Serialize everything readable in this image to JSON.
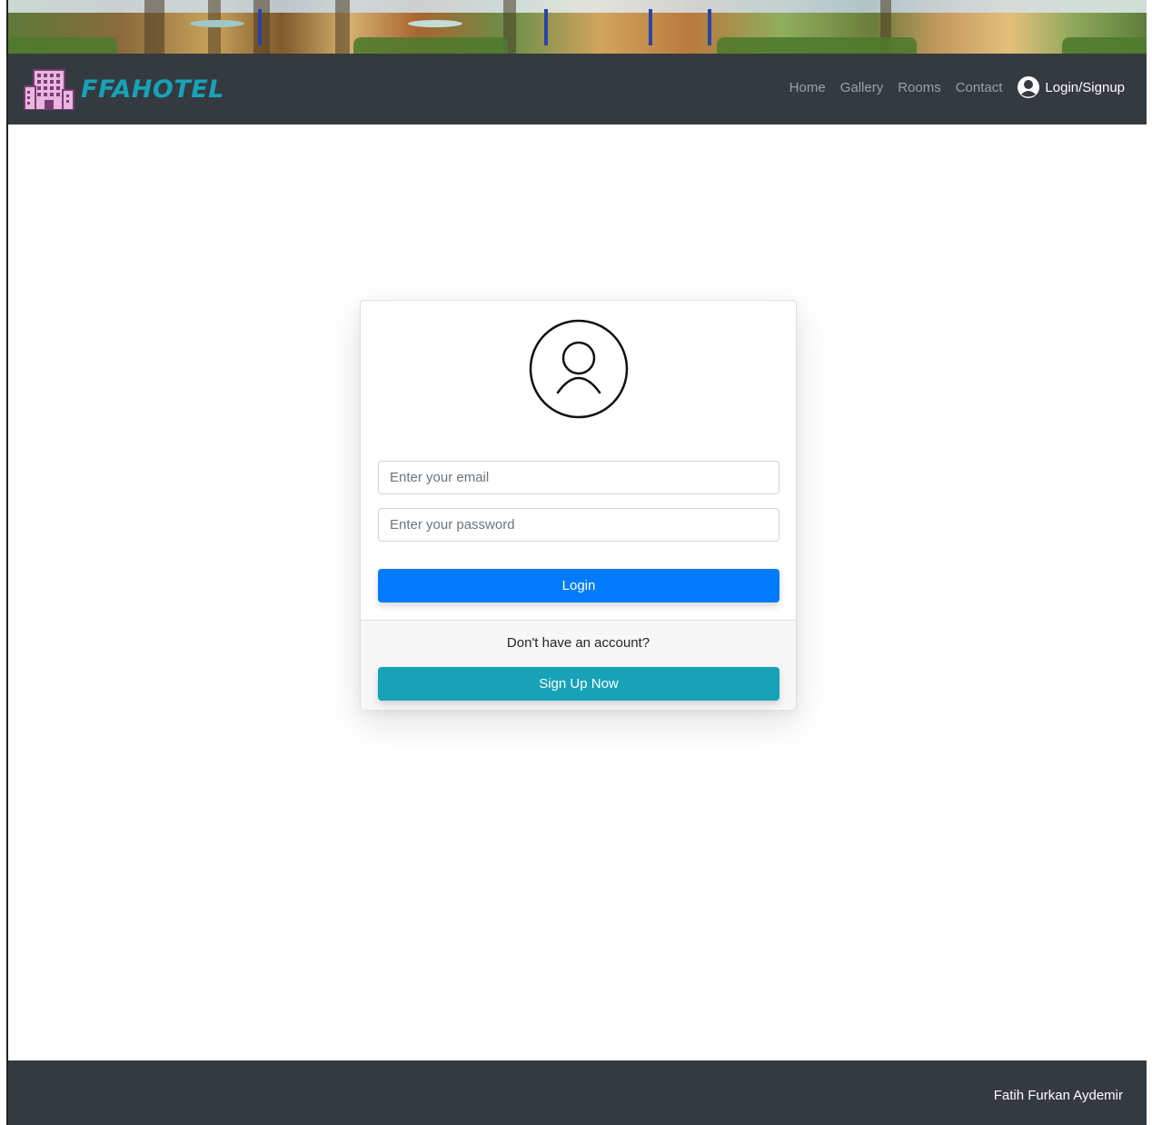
{
  "brand": {
    "name": "FFAHOTEL",
    "color": "#17a2b8"
  },
  "nav": {
    "links": [
      "Home",
      "Gallery",
      "Rooms",
      "Contact"
    ],
    "login_label": "Login/Signup"
  },
  "login_card": {
    "email_placeholder": "Enter your email",
    "password_placeholder": "Enter your password",
    "login_button": "Login",
    "no_account_text": "Don't have an account?",
    "signup_button": "Sign Up Now"
  },
  "footer": {
    "author": "Fatih Furkan Aydemir"
  },
  "colors": {
    "navbar": "#343a40",
    "primary": "#007bff",
    "info": "#17a2b8"
  }
}
